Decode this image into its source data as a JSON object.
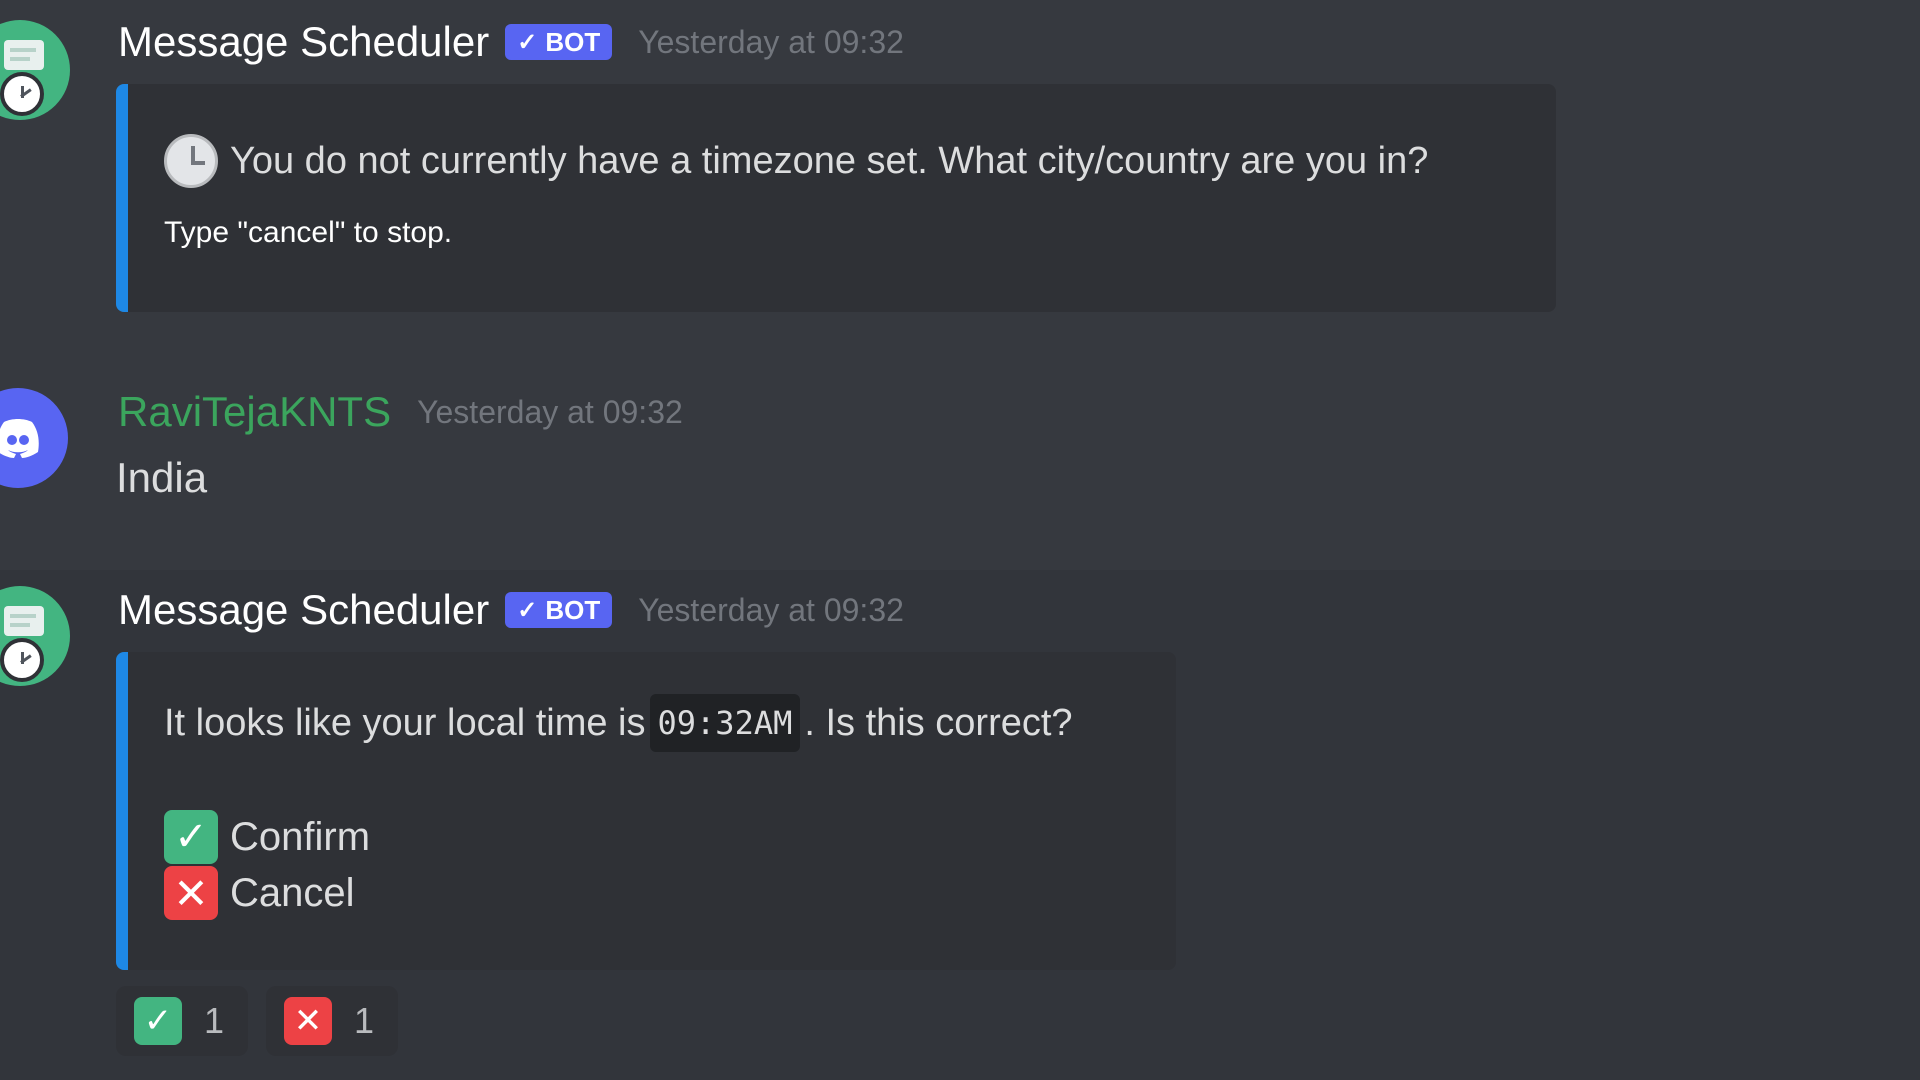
{
  "messages": [
    {
      "author": "Message Scheduler",
      "bot_tag": "BOT",
      "timestamp": "Yesterday at 09:32",
      "embed": {
        "main": "You do not currently have a timezone set. What city/country are you in?",
        "sub": "Type \"cancel\" to stop."
      }
    },
    {
      "author": "RaviTejaKNTS",
      "timestamp": "Yesterday at 09:32",
      "text": "India"
    },
    {
      "author": "Message Scheduler",
      "bot_tag": "BOT",
      "timestamp": "Yesterday at 09:32",
      "embed": {
        "main_prefix": "It looks like your local time is ",
        "time_code": "09:32AM",
        "main_suffix": ". Is this correct?",
        "confirm_label": "Confirm",
        "cancel_label": "Cancel"
      },
      "reactions": [
        {
          "emoji": "white-check-mark",
          "count": "1"
        },
        {
          "emoji": "x",
          "count": "1"
        }
      ]
    }
  ],
  "colors": {
    "background": "#36393f",
    "embed_bar": "#1e88e5",
    "bot_tag": "#5865f2",
    "user_name": "#3ba55d"
  }
}
